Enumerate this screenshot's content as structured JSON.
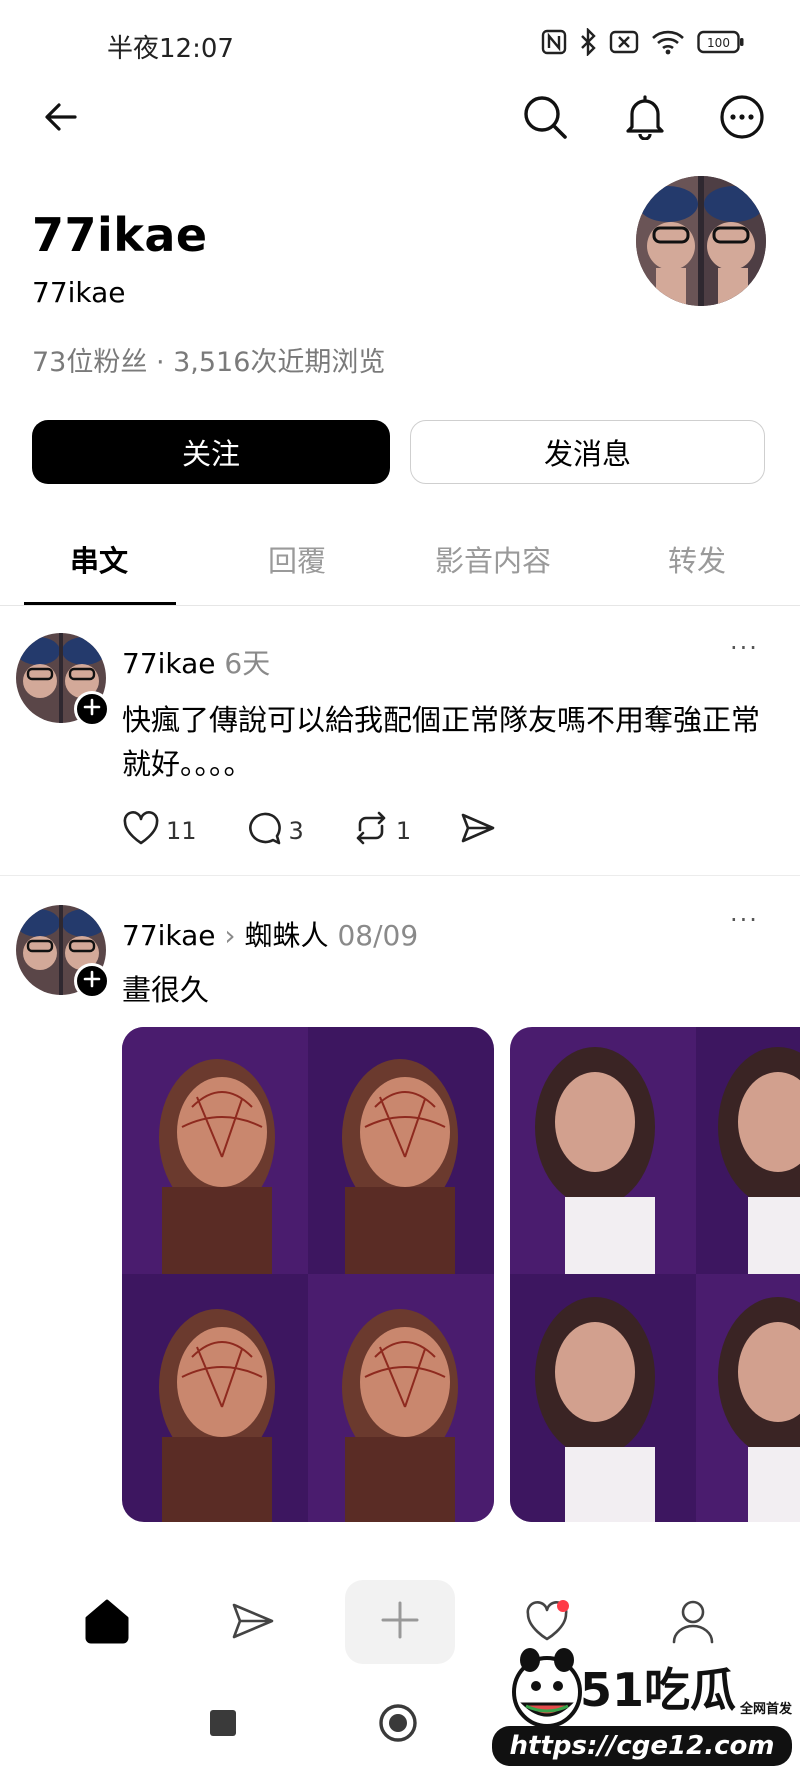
{
  "status_bar": {
    "time": "半夜12:07",
    "battery": "100",
    "icons": [
      "nfc-icon",
      "bluetooth-icon",
      "mute-icon",
      "wifi-icon",
      "battery-icon"
    ]
  },
  "top_nav": {
    "icons": [
      "back-arrow-icon",
      "search-icon",
      "bell-icon",
      "more-icon"
    ]
  },
  "profile": {
    "name": "77ikae",
    "handle": "77ikae",
    "stats": "73位粉丝 · 3,516次近期浏览"
  },
  "actions": {
    "follow_label": "关注",
    "message_label": "发消息"
  },
  "tabs": [
    "串文",
    "回覆",
    "影音内容",
    "转发"
  ],
  "posts": [
    {
      "author": "77ikae",
      "meta": "6天",
      "text": "快瘋了傳說可以給我配個正常隊友嗎不用奪強正常就好。。。。",
      "likes": "11",
      "comments": "3",
      "reposts": "1"
    },
    {
      "author": "77ikae",
      "breadcrumb_sep": "›",
      "topic": "蜘蛛人",
      "meta": "08/09",
      "text": "畫很久"
    }
  ],
  "bottom_nav": {
    "icons": [
      "home-icon",
      "send-icon",
      "compose-icon",
      "activity-icon",
      "profile-icon"
    ]
  },
  "watermark": {
    "brand": "吃瓜",
    "number": "51",
    "tagline": "全网首发",
    "url": "https://cge12.com"
  },
  "colors": {
    "accent": "#000000",
    "muted": "#8a8a8a",
    "notification_dot": "#ff3b47"
  }
}
